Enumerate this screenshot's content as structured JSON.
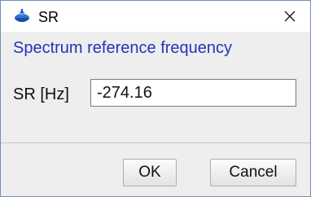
{
  "window": {
    "title": "SR",
    "app_icon": "blue-spinning-top-icon",
    "close_icon": "close-icon"
  },
  "dialog": {
    "heading": "Spectrum reference frequency",
    "field_label": "SR [Hz]",
    "field_value": "-274.16"
  },
  "buttons": {
    "ok": "OK",
    "cancel": "Cancel"
  },
  "colors": {
    "heading": "#2233bb",
    "panel_background": "#eeeeee",
    "window_border": "#6f8fb8"
  }
}
